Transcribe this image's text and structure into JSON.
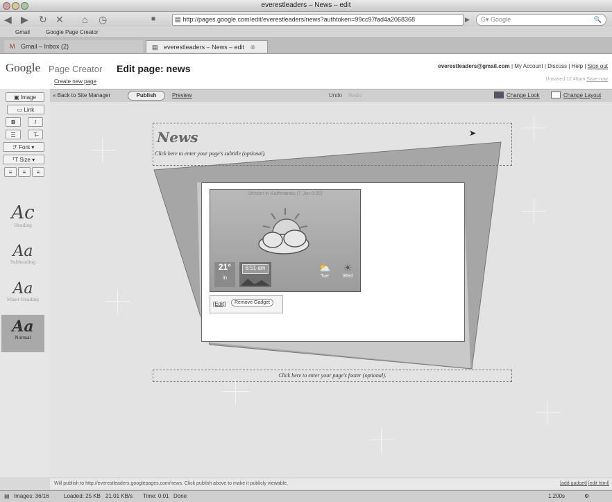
{
  "window": {
    "title": "everestleaders – News – edit"
  },
  "browser": {
    "url": "http://pages.google.com/edit/everestleaders/news?authtoken=99cc97fad4a2068368",
    "search_placeholder": "Google"
  },
  "bookmarks": [
    "Gmail",
    "Google Page Creator"
  ],
  "tabs": [
    {
      "label": "Gmail – Inbox (2)"
    },
    {
      "label": "everestleaders – News – edit"
    }
  ],
  "header": {
    "logo": "Google",
    "product": "Page Creator",
    "edit_page": "Edit page: news",
    "create_new": "Create new page",
    "account_email": "everestleaders@gmail.com",
    "account_links": "| My Account | Discuss | Help |",
    "sign_out": "Sign out",
    "unsaved": "Unsaved 12:46am",
    "save_now": "Save now"
  },
  "editor": {
    "back": "« Back to Site Manager",
    "publish": "Publish",
    "preview": "Preview",
    "undo": "Undo",
    "redo": "Redo",
    "change_look": "Change Look",
    "change_layout": "Change Layout"
  },
  "tools": {
    "image": "Image",
    "link": "Link",
    "bold": "B",
    "italic": "I",
    "font": "Font",
    "size": "Size",
    "samples": [
      {
        "glyph": "Ac",
        "label": "Heading"
      },
      {
        "glyph": "Aa",
        "label": "Subheading"
      },
      {
        "glyph": "Aa",
        "label": "Minor Heading"
      },
      {
        "glyph": "Aa",
        "label": "Normal"
      }
    ]
  },
  "page": {
    "title": "News",
    "subtitle": "Click here to enter your page's subtitle (optional).",
    "footer": "Click here to enter your page's footer (optional)."
  },
  "gadget": {
    "version": "Version in Kathmandu (7 Jan 8:35)",
    "temp": "21°",
    "unit": "in",
    "time": "6:51 am",
    "day1": "Tue",
    "day2": "Wed",
    "edit": "[Edit]",
    "remove": "Remove Gadget"
  },
  "footer_bar": {
    "publish_note": "Will publish to http://everestleaders.googlepages.com/news. Click publish above to make it publicly viewable.",
    "add_gadget": "[add gadget]",
    "edit_html": "[edit html]"
  },
  "status": {
    "images": "Images: 36/16",
    "loaded": "Loaded: 25 KB",
    "rate": "21.01 KB/s",
    "time": "Time: 0:01",
    "state": "Done",
    "zoom": "1.200s"
  },
  "colors": {
    "canvas": "#e3e3e3",
    "frame": "#a6a6a6",
    "accent_red": "#b44"
  }
}
